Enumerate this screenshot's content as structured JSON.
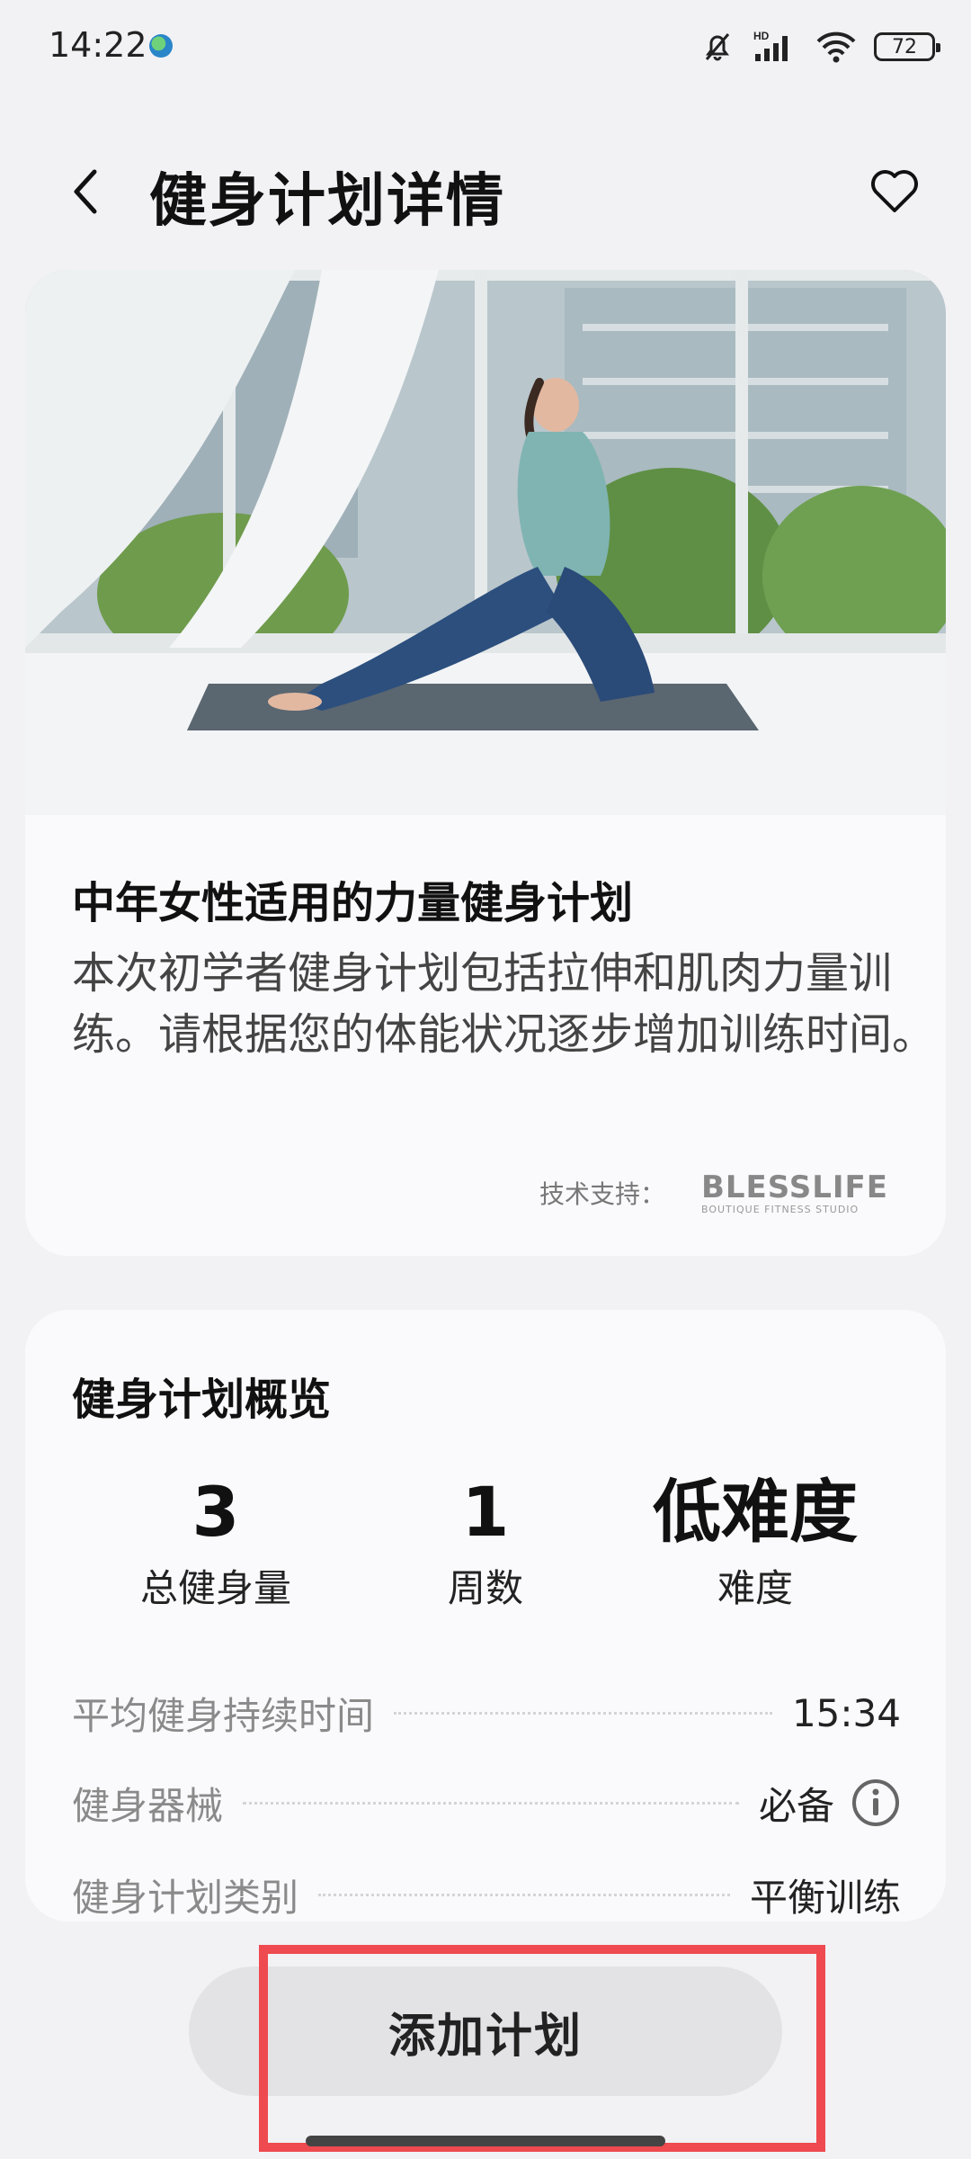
{
  "status_bar": {
    "time": "14:22",
    "network_label": "HD",
    "battery": "72",
    "icons": [
      "app-notification-icon",
      "mute-bell-icon",
      "cellular-signal-icon",
      "wifi-icon",
      "battery-icon"
    ]
  },
  "header": {
    "title": "健身计划详情",
    "back_icon": "chevron-left-icon",
    "favorite_icon": "heart-outline-icon"
  },
  "plan": {
    "title": "中年女性适用的力量健身计划",
    "description": "本次初学者健身计划包括拉伸和肌肉力量训练。请根据您的体能状况逐步增加训练时间。",
    "support_label": "技术支持：",
    "brand_name": "BLESSLIFE",
    "brand_sub": "BOUTIQUE FITNESS STUDIO"
  },
  "overview": {
    "title": "健身计划概览",
    "stats": [
      {
        "value": "3",
        "label": "总健身量"
      },
      {
        "value": "1",
        "label": "周数"
      },
      {
        "value": "低难度",
        "label": "难度"
      }
    ],
    "rows": [
      {
        "label": "平均健身持续时间",
        "value": "15:34"
      },
      {
        "label": "健身器械",
        "value": "必备"
      },
      {
        "label": "健身计划类别",
        "value": "平衡训练"
      }
    ]
  },
  "actions": {
    "add_plan_label": "添加计划"
  },
  "colors": {
    "background": "#f2f2f5",
    "card": "#fafafc",
    "button": "#e3e3e6",
    "highlight": "#ee4a4f"
  }
}
